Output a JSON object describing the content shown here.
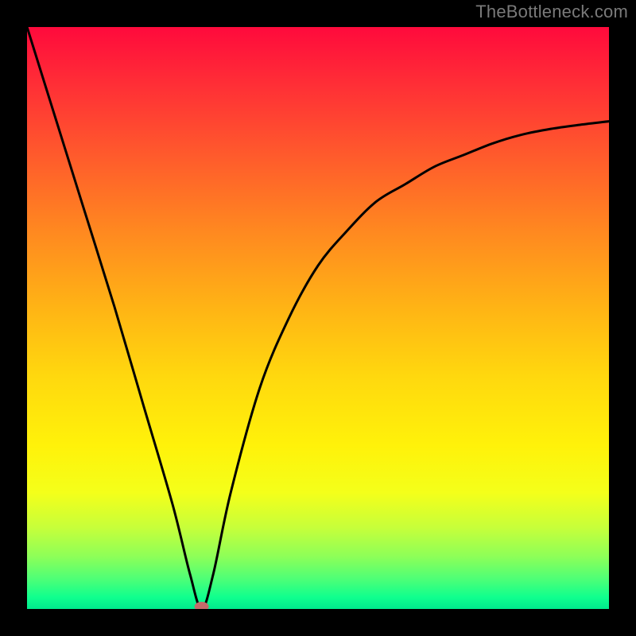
{
  "watermark": "TheBottleneck.com",
  "chart_data": {
    "type": "line",
    "title": "",
    "xlabel": "",
    "ylabel": "",
    "xlim": [
      0,
      100
    ],
    "ylim": [
      0,
      100
    ],
    "series": [
      {
        "name": "curve",
        "x": [
          0,
          5,
          10,
          15,
          20,
          25,
          28,
          30,
          32,
          35,
          40,
          45,
          50,
          55,
          60,
          65,
          70,
          75,
          80,
          85,
          90,
          95,
          100
        ],
        "y": [
          100,
          84,
          68,
          52,
          35,
          18,
          6,
          0,
          6,
          20,
          38,
          50,
          59,
          65,
          70,
          73,
          76,
          78,
          80,
          81.5,
          82.5,
          83.2,
          83.8
        ]
      }
    ],
    "marker": {
      "x": 30,
      "y": 0,
      "color": "#c46a6a"
    },
    "notes": "Percent-scale axes; background is a vertical red→green gradient indicating bottleneck severity."
  },
  "colors": {
    "frame": "#000000",
    "curve": "#000000",
    "marker": "#c46a6a",
    "watermark": "#7a7a7a"
  }
}
